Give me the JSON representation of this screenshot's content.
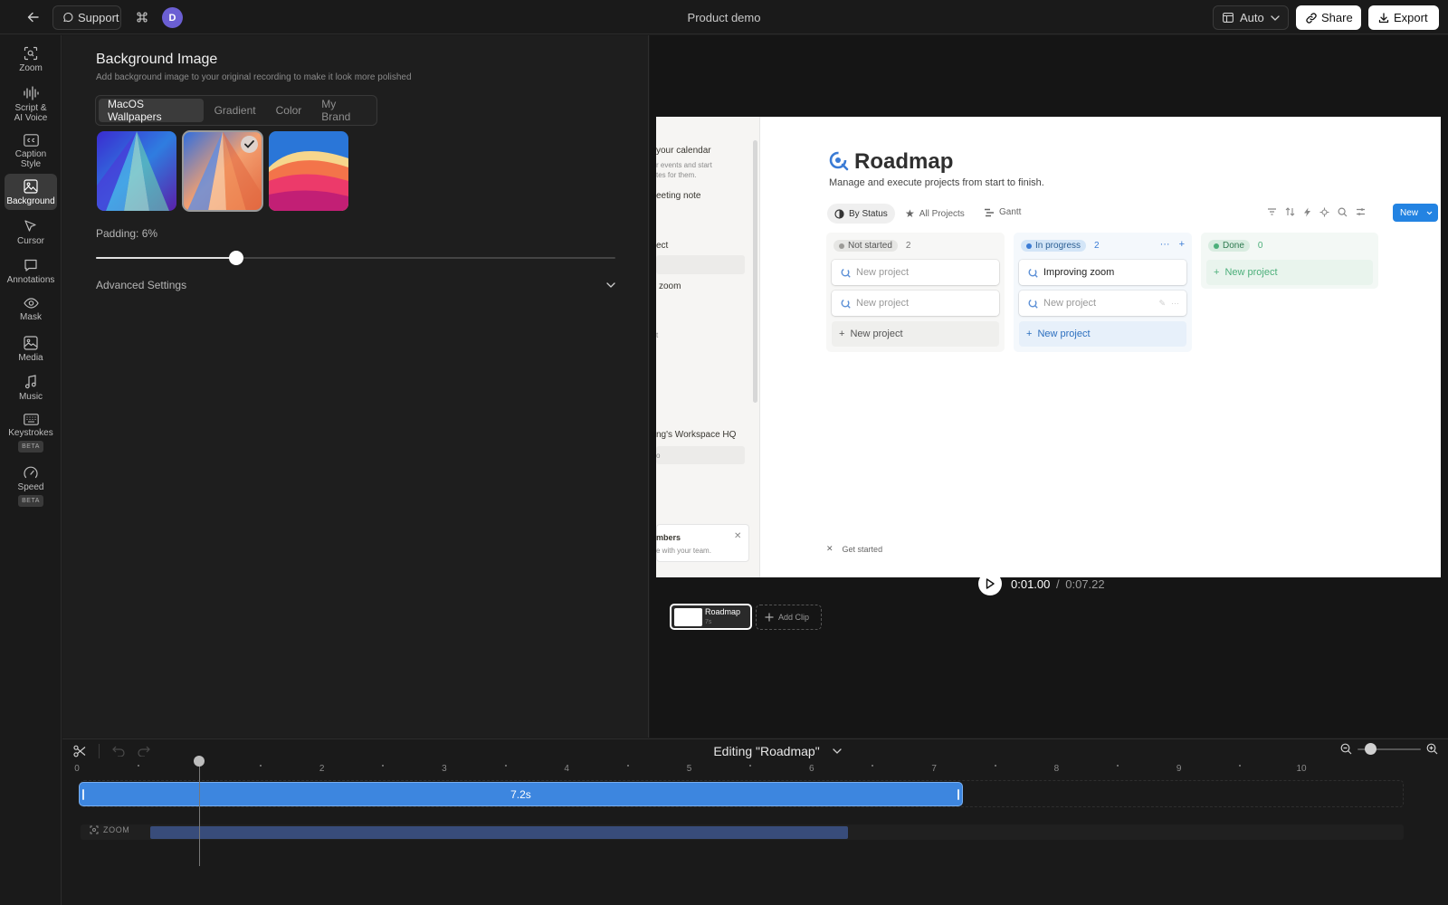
{
  "topbar": {
    "support_label": "Support",
    "avatar_initial": "D",
    "title": "Product demo",
    "layout_label": "Auto",
    "share_label": "Share",
    "export_label": "Export"
  },
  "sidebar": {
    "items": [
      {
        "label": "Zoom",
        "icon": "zoom-icon"
      },
      {
        "label": "Script & AI Voice",
        "icon": "waveform-icon"
      },
      {
        "label": "Caption Style",
        "icon": "caption-icon"
      },
      {
        "label": "Background",
        "icon": "image-icon",
        "active": true
      },
      {
        "label": "Cursor",
        "icon": "cursor-icon"
      },
      {
        "label": "Annotations",
        "icon": "comment-icon"
      },
      {
        "label": "Mask",
        "icon": "eye-icon"
      },
      {
        "label": "Media",
        "icon": "media-icon"
      },
      {
        "label": "Music",
        "icon": "music-icon"
      },
      {
        "label": "Keystrokes",
        "icon": "keyboard-icon",
        "badge": "BETA"
      },
      {
        "label": "Speed",
        "icon": "speedometer-icon",
        "badge": "BETA"
      }
    ]
  },
  "panel": {
    "title": "Background Image",
    "subtitle": "Add background image to your original recording to make it look more polished",
    "tabs": [
      "MacOS Wallpapers",
      "Gradient",
      "Color",
      "My Brand"
    ],
    "active_tab": 0,
    "selected_wallpaper": 1,
    "padding_label": "Padding: 6%",
    "padding_slider_fraction": 0.27,
    "advanced_label": "Advanced Settings"
  },
  "video": {
    "page_title": "Roadmap",
    "page_subtitle": "Manage and execute projects from start to finish.",
    "views": [
      "By Status",
      "All Projects",
      "Gantt"
    ],
    "new_button": "New",
    "sidebar_text": {
      "calendar": "your calendar",
      "calendar_desc_1": "r events and start",
      "calendar_desc_2": "tes for them.",
      "meeting": "eeting note",
      "project": "ect",
      "zoom": "zoom",
      "t": "t",
      "workspace": "ng's Workspace HQ",
      "o": "o",
      "members": "mbers",
      "members_desc": "e with your team."
    },
    "get_started": "Get started",
    "columns": [
      {
        "status": "Not started",
        "count": "2",
        "cards": [
          "New project",
          "New project"
        ],
        "add": "New project"
      },
      {
        "status": "In progress",
        "count": "2",
        "cards": [
          "Improving zoom",
          "New project"
        ],
        "add": "New project"
      },
      {
        "status": "Done",
        "count": "0",
        "cards": [],
        "add": "New project"
      }
    ]
  },
  "player": {
    "current_time": "0:01.00",
    "separator": "/",
    "total_time": "0:07.22"
  },
  "clips": {
    "clip_name": "Roadmap",
    "clip_duration": "7s",
    "add_clip_label": "Add Clip"
  },
  "timeline": {
    "editing_label": "Editing \"Roadmap\"",
    "ticks": [
      "0",
      "1",
      "2",
      "3",
      "4",
      "5",
      "6",
      "7",
      "8",
      "9",
      "10"
    ],
    "clip_label": "7.2s",
    "zoom_track_label": "ZOOM",
    "clip_duration_seconds": 7.22,
    "playhead_seconds": 1.0,
    "zoom_region_end_seconds": 6.3
  },
  "colors": {
    "accent_blue": "#3d86df",
    "zoom_track": "#384c7a",
    "avatar": "#6b5fd3"
  }
}
